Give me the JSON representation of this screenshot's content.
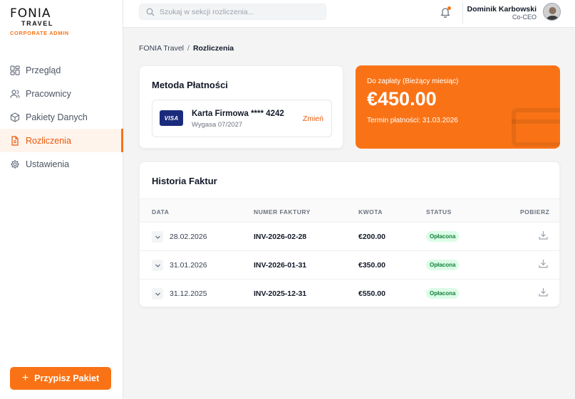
{
  "brand": {
    "name_top": "FONIA",
    "name_bottom": "TRAVEL",
    "subtitle": "CORPORATE ADMIN",
    "accent_color": "#f97316"
  },
  "sidebar": {
    "items": [
      {
        "label": "Przegląd",
        "icon": "grid-icon",
        "active": false
      },
      {
        "label": "Pracownicy",
        "icon": "users-icon",
        "active": false
      },
      {
        "label": "Pakiety Danych",
        "icon": "package-icon",
        "active": false
      },
      {
        "label": "Rozliczenia",
        "icon": "document-icon",
        "active": true
      },
      {
        "label": "Ustawienia",
        "icon": "gear-icon",
        "active": false
      }
    ],
    "assign_button": "Przypisz Pakiet"
  },
  "header": {
    "search_placeholder": "Szukaj w sekcji rozliczenia...",
    "user_name": "Dominik Karbowski",
    "user_role": "Co-CEO"
  },
  "breadcrumb": {
    "root": "FONIA Travel",
    "separator": "/",
    "current": "Rozliczenia"
  },
  "payment_method": {
    "title": "Metoda Płatności",
    "card_brand": "VISA",
    "card_name": "Karta Firmowa **** 4242",
    "expiry": "Wygasa 07/2027",
    "change_label": "Zmień"
  },
  "amount_due": {
    "label": "Do zapłaty (Bieżący miesiąc)",
    "amount": "€450.00",
    "due_date": "Termin płatności: 31.03.2026"
  },
  "invoices": {
    "title": "Historia Faktur",
    "columns": [
      "DATA",
      "NUMER FAKTURY",
      "KWOTA",
      "STATUS",
      "POBIERZ"
    ],
    "rows": [
      {
        "date": "28.02.2026",
        "number": "INV-2026-02-28",
        "amount": "€200.00",
        "status": "Opłacona"
      },
      {
        "date": "31.01.2026",
        "number": "INV-2026-01-31",
        "amount": "€350.00",
        "status": "Opłacona"
      },
      {
        "date": "31.12.2025",
        "number": "INV-2025-12-31",
        "amount": "€550.00",
        "status": "Opłacona"
      }
    ]
  }
}
